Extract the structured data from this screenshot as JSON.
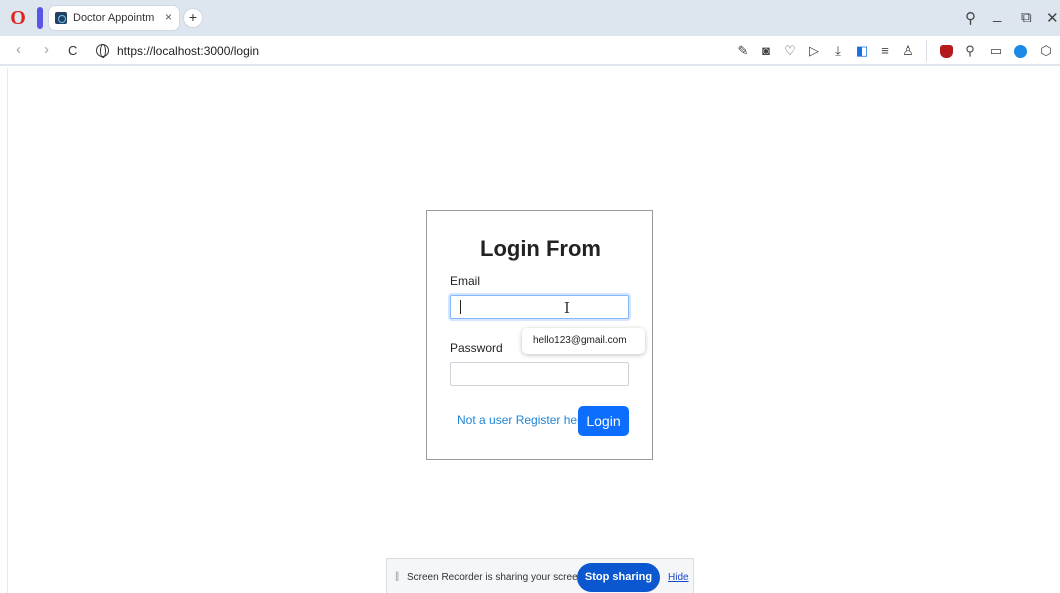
{
  "browser": {
    "tab_title": "Doctor Appointment S",
    "tab_close": "×",
    "new_tab": "+",
    "url": "https://localhost:3000/login",
    "nav": {
      "back": "‹",
      "forward": "›",
      "reload": "C"
    },
    "window_controls": {
      "search": "⚲",
      "minimize": "_",
      "restore": "⧉",
      "close": "✕"
    },
    "toolbar_icons": [
      "edit-icon",
      "camera-icon",
      "heart-icon",
      "send-icon",
      "download-icon",
      "toggle-icon",
      "menu-icon",
      "profile-icon",
      "ublock-icon",
      "zoom-icon",
      "window-icon",
      "blue-extension-icon",
      "box-icon"
    ]
  },
  "login": {
    "title": "Login From",
    "email_label": "Email",
    "email_value": "",
    "password_label": "Password",
    "password_value": "",
    "register_link": "Not a user Register here",
    "login_button": "Login",
    "autofill_suggestion": "hello123@gmail.com"
  },
  "share_bar": {
    "message": "Screen Recorder is sharing your screen.",
    "stop_button": "Stop sharing",
    "hide_link": "Hide"
  },
  "colors": {
    "primary": "#0d6efd",
    "link": "#1f86d8",
    "stop_sharing": "#0b57d0",
    "tabstrip": "#dde5ee"
  }
}
